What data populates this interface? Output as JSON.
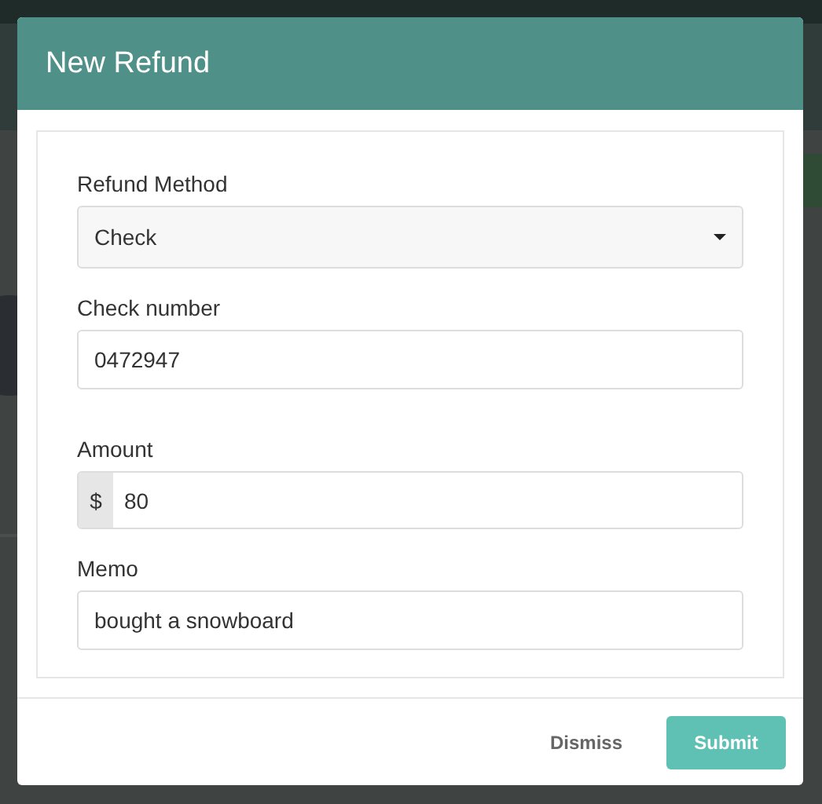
{
  "modal": {
    "title": "New Refund"
  },
  "fields": [
    {
      "kind": "select",
      "label": "Refund Method",
      "value": "Check"
    },
    {
      "kind": "text",
      "label": "Check number",
      "value": "0472947"
    },
    {
      "kind": "currency",
      "label": "Amount",
      "prefix": "$",
      "value": "80"
    },
    {
      "kind": "text",
      "label": "Memo",
      "value": "bought a snowboard"
    }
  ],
  "buttons": [
    {
      "kind": "link",
      "label": "Dismiss"
    },
    {
      "kind": "primary",
      "label": "Submit"
    }
  ]
}
